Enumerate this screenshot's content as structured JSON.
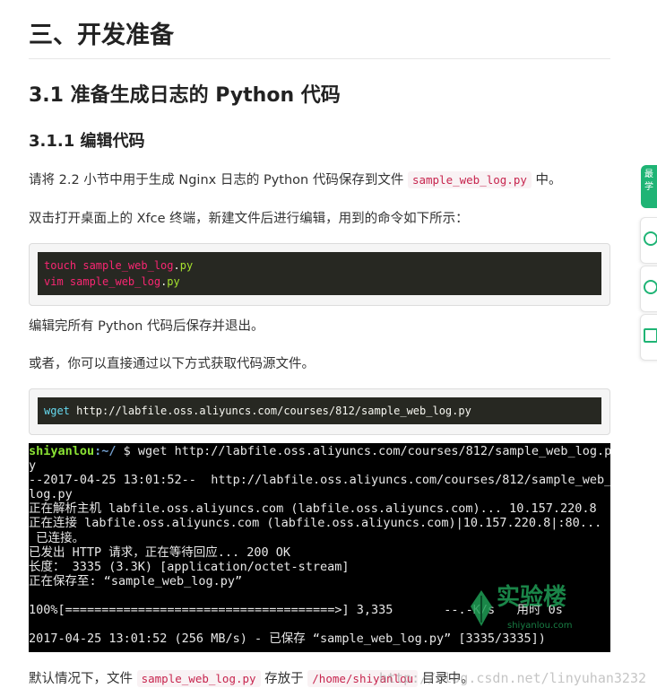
{
  "headings": {
    "main": "三、开发准备",
    "sub": "3.1 准备生成日志的 Python 代码",
    "subsub": "3.1.1 编辑代码"
  },
  "paragraphs": {
    "p1_before": "请将 2.2 小节中用于生成 Nginx 日志的 Python 代码保存到文件 ",
    "p1_code": "sample_web_log.py",
    "p1_after": " 中。",
    "p2": "双击打开桌面上的 Xfce 终端，新建文件后进行编辑，用到的命令如下所示：",
    "p3": "编辑完所有 Python 代码后保存并退出。",
    "p4": "或者，你可以直接通过以下方式获取代码源文件。",
    "p5_before": "默认情况下，文件 ",
    "p5_code1": "sample_web_log.py",
    "p5_mid": " 存放于 ",
    "p5_code2": "/home/shiyanlou",
    "p5_after": " 目录中。"
  },
  "code_block_1": {
    "line1_cmd": "touch",
    "line1_file": " sample_web_log",
    "line1_dot": ".",
    "line1_ext": "py",
    "line2_cmd": "vim",
    "line2_file": " sample_web_log",
    "line2_dot": ".",
    "line2_ext": "py"
  },
  "code_block_2": {
    "cmd": "wget",
    "args": " http://labfile.oss.aliyuncs.com/courses/812/sample_web_log.py"
  },
  "terminal": {
    "prompt_user": "shiyanlou",
    "prompt_path": ":~/",
    "prompt_cmd": " $ wget http://labfile.oss.aliyuncs.com/courses/812/sample_web_log.p",
    "lines": [
      "y",
      "--2017-04-25 13:01:52--  http://labfile.oss.aliyuncs.com/courses/812/sample_web_",
      "log.py",
      "正在解析主机 labfile.oss.aliyuncs.com (labfile.oss.aliyuncs.com)... 10.157.220.8",
      "正在连接 labfile.oss.aliyuncs.com (labfile.oss.aliyuncs.com)|10.157.220.8|:80...",
      " 已连接。",
      "已发出 HTTP 请求，正在等待回应... 200 OK",
      "长度： 3335 (3.3K) [application/octet-stream]",
      "正在保存至: “sample_web_log.py”",
      "",
      "100%[=====================================>] 3,335       --.-K/s   用时 0s",
      "",
      "2017-04-25 13:01:52 (256 MB/s) - 已保存 “sample_web_log.py” [3335/3335])"
    ],
    "watermark_text": "实验楼",
    "watermark_sub": "shiyanlou.com"
  },
  "blog_watermark": "http://blog.csdn.net/linyuhan3232",
  "side_panel": {
    "tab_label": "最学",
    "icons": [
      "chat-icon",
      "comment-icon",
      "note-icon"
    ]
  },
  "colors": {
    "code_bg": "#272822",
    "inline_code_text": "#c7254e",
    "accent_green": "#1fb475"
  }
}
